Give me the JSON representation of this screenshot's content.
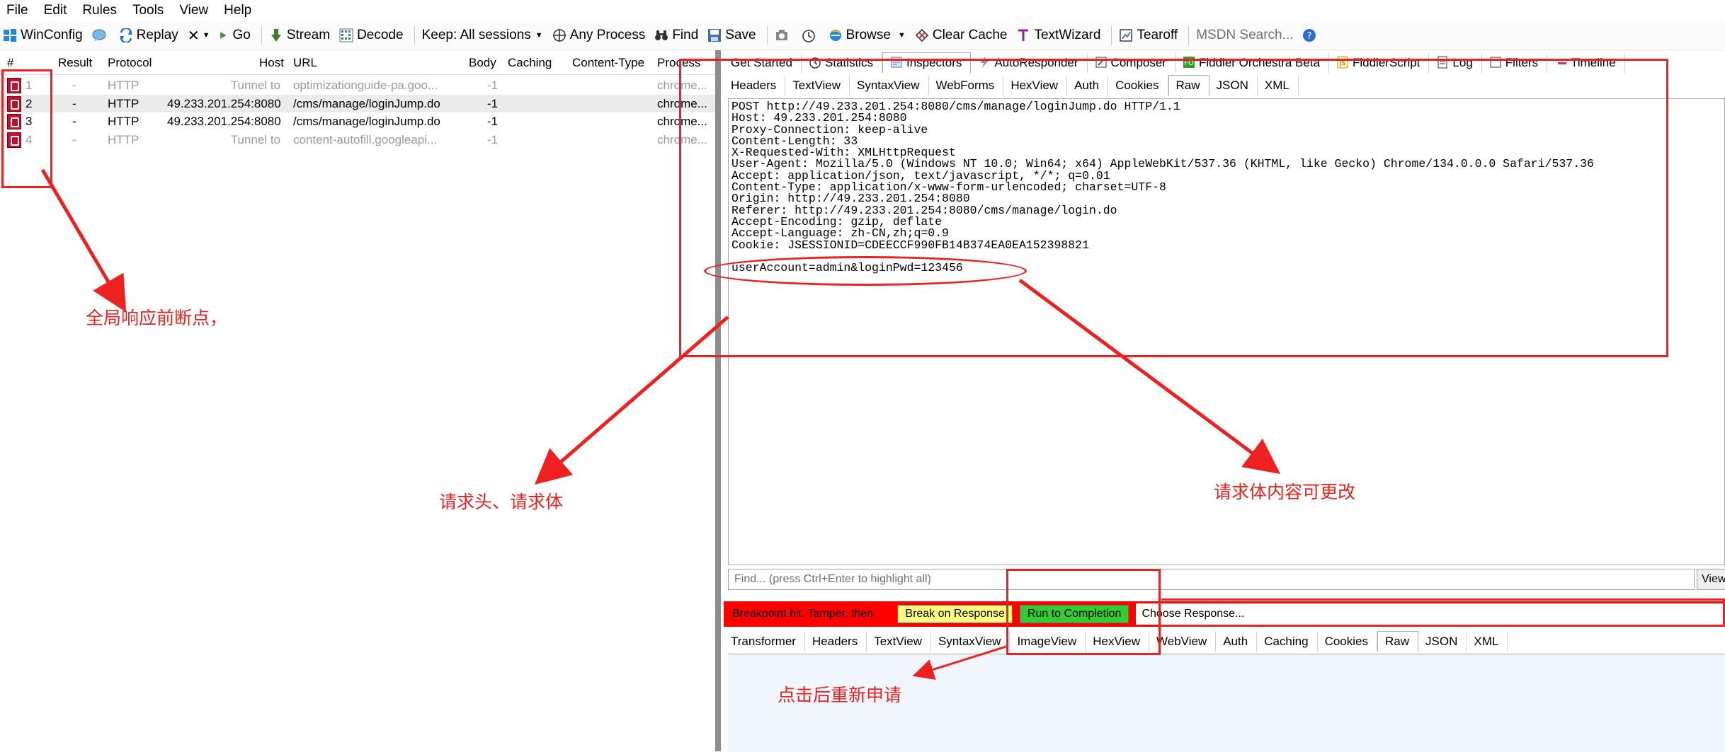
{
  "menu": [
    "File",
    "Edit",
    "Rules",
    "Tools",
    "View",
    "Help"
  ],
  "toolbar": {
    "winconfig": "WinConfig",
    "replay": "Replay",
    "remove": "✕",
    "go": "Go",
    "stream": "Stream",
    "decode": "Decode",
    "keep": "Keep: All sessions",
    "process": "Any Process",
    "find": "Find",
    "save": "Save",
    "browse": "Browse",
    "clear_cache": "Clear Cache",
    "textwizard": "TextWizard",
    "tearoff": "Tearoff",
    "msdn": "MSDN Search..."
  },
  "sessions": {
    "headers": [
      "#",
      "Result",
      "Protocol",
      "Host",
      "URL",
      "Body",
      "Caching",
      "Content-Type",
      "Process"
    ],
    "rows": [
      {
        "num": "1",
        "result": "-",
        "protocol": "HTTP",
        "host": "Tunnel to",
        "url": "optimizationguide-pa.goo...",
        "body": "-1",
        "process": "chrome...",
        "style": "gray"
      },
      {
        "num": "2",
        "result": "-",
        "protocol": "HTTP",
        "host": "49.233.201.254:8080",
        "url": "/cms/manage/loginJump.do",
        "body": "-1",
        "process": "chrome...",
        "style": "sel"
      },
      {
        "num": "3",
        "result": "-",
        "protocol": "HTTP",
        "host": "49.233.201.254:8080",
        "url": "/cms/manage/loginJump.do",
        "body": "-1",
        "process": "chrome...",
        "style": "normal"
      },
      {
        "num": "4",
        "result": "-",
        "protocol": "HTTP",
        "host": "Tunnel to",
        "url": "content-autofill.googleapi...",
        "body": "-1",
        "process": "chrome...",
        "style": "gray"
      }
    ]
  },
  "main_tabs": [
    "Get Started",
    "Statistics",
    "Inspectors",
    "AutoResponder",
    "Composer",
    "Fiddler Orchestra Beta",
    "FiddlerScript",
    "Log",
    "Filters",
    "Timeline"
  ],
  "request_tabs": [
    "Headers",
    "TextView",
    "SyntaxView",
    "WebForms",
    "HexView",
    "Auth",
    "Cookies",
    "Raw",
    "JSON",
    "XML"
  ],
  "request_active": "Raw",
  "raw_lines": [
    "POST http://49.233.201.254:8080/cms/manage/loginJump.do HTTP/1.1",
    "Host: 49.233.201.254:8080",
    "Proxy-Connection: keep-alive",
    "Content-Length: 33",
    "X-Requested-With: XMLHttpRequest",
    "User-Agent: Mozilla/5.0 (Windows NT 10.0; Win64; x64) AppleWebKit/537.36 (KHTML, like Gecko) Chrome/134.0.0.0 Safari/537.36",
    "Accept: application/json, text/javascript, */*; q=0.01",
    "Content-Type: application/x-www-form-urlencoded; charset=UTF-8",
    "Origin: http://49.233.201.254:8080",
    "Referer: http://49.233.201.254:8080/cms/manage/login.do",
    "Accept-Encoding: gzip, deflate",
    "Accept-Language: zh-CN,zh;q=0.9",
    "Cookie: JSESSIONID=CDEECCF990FB14B374EA0EA152398821",
    "",
    "userAccount=admin&loginPwd=123456"
  ],
  "find_placeholder": "Find... (press Ctrl+Enter to highlight all)",
  "view_button": "View",
  "breakpoint": {
    "label": "Breakpoint hit. Tamper, then:",
    "break_on_response": "Break on Response",
    "run_to_completion": "Run to Completion",
    "choose_response": "Choose Response...",
    "colors": {
      "bar": "#ff0000",
      "break_btn": "#ffff80",
      "run_btn": "#33cc33"
    }
  },
  "response_tabs": [
    "Transformer",
    "Headers",
    "TextView",
    "SyntaxView",
    "ImageView",
    "HexView",
    "WebView",
    "Auth",
    "Caching",
    "Cookies",
    "Raw",
    "JSON",
    "XML"
  ],
  "response_active": "Raw",
  "annotations": {
    "global_breakpoint": "全局响应前断点，",
    "request_headers": "请求头、请求体",
    "request_body": "请求体内容可更改",
    "click_resubmit": "点击后重新申请",
    "color": "#ee2020"
  }
}
